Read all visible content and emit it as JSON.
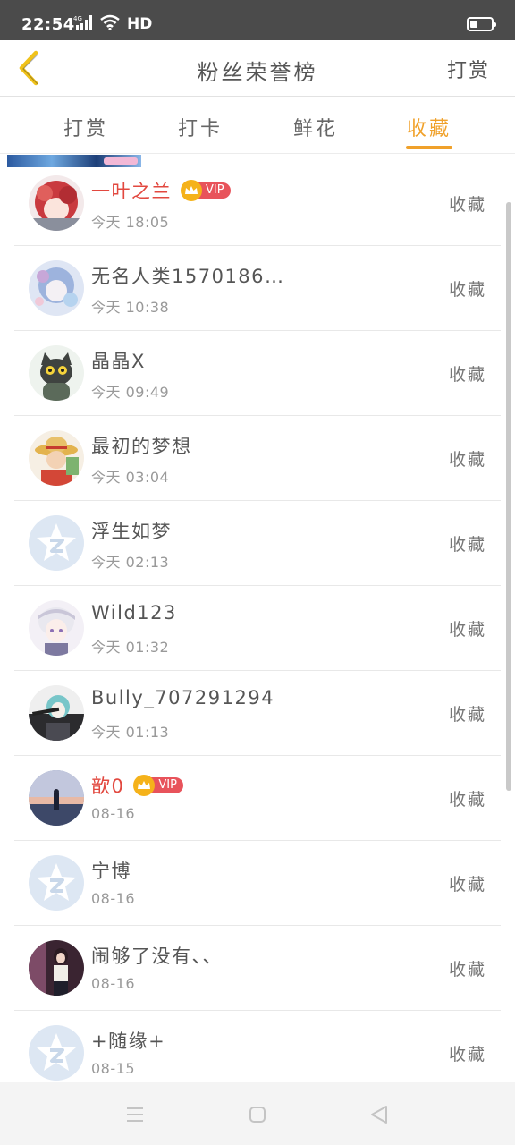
{
  "status_bar": {
    "time": "22:54",
    "network": "4G",
    "hd": "HD",
    "battery_level": 0.35
  },
  "header": {
    "title": "粉丝荣誉榜",
    "right_action": "打赏"
  },
  "tabs": [
    {
      "label": "打赏",
      "active": false
    },
    {
      "label": "打卡",
      "active": false
    },
    {
      "label": "鲜花",
      "active": false
    },
    {
      "label": "收藏",
      "active": true
    }
  ],
  "vip_label": "VIP",
  "accent_color": "#f0a12a",
  "vip_name_color": "#e2483f",
  "items": [
    {
      "name": "一叶之兰",
      "time": "今天 18:05",
      "action": "收藏",
      "vip": true,
      "avatar": "anime-red-hair"
    },
    {
      "name": "无名人类1570186…",
      "time": "今天 10:38",
      "action": "收藏",
      "vip": false,
      "avatar": "anime-blue"
    },
    {
      "name": "晶晶X",
      "time": "今天 09:49",
      "action": "收藏",
      "vip": false,
      "avatar": "cat-hoodie"
    },
    {
      "name": "最初的梦想",
      "time": "今天 03:04",
      "action": "收藏",
      "vip": false,
      "avatar": "straw-hat"
    },
    {
      "name": "浮生如梦",
      "time": "今天 02:13",
      "action": "收藏",
      "vip": false,
      "avatar": "default"
    },
    {
      "name": "Wild123",
      "time": "今天 01:32",
      "action": "收藏",
      "vip": false,
      "avatar": "anime-white-hair"
    },
    {
      "name": "Bully_707291294",
      "time": "今天 01:13",
      "action": "收藏",
      "vip": false,
      "avatar": "anime-dark"
    },
    {
      "name": "歆0",
      "time": "08-16",
      "action": "收藏",
      "vip": true,
      "avatar": "photo-dusk"
    },
    {
      "name": "宁博",
      "time": "08-16",
      "action": "收藏",
      "vip": false,
      "avatar": "default"
    },
    {
      "name": "闹够了没有、、",
      "time": "08-16",
      "action": "收藏",
      "vip": false,
      "avatar": "photo-girl"
    },
    {
      "name": "+随缘+",
      "time": "08-15",
      "action": "收藏",
      "vip": false,
      "avatar": "default"
    }
  ]
}
